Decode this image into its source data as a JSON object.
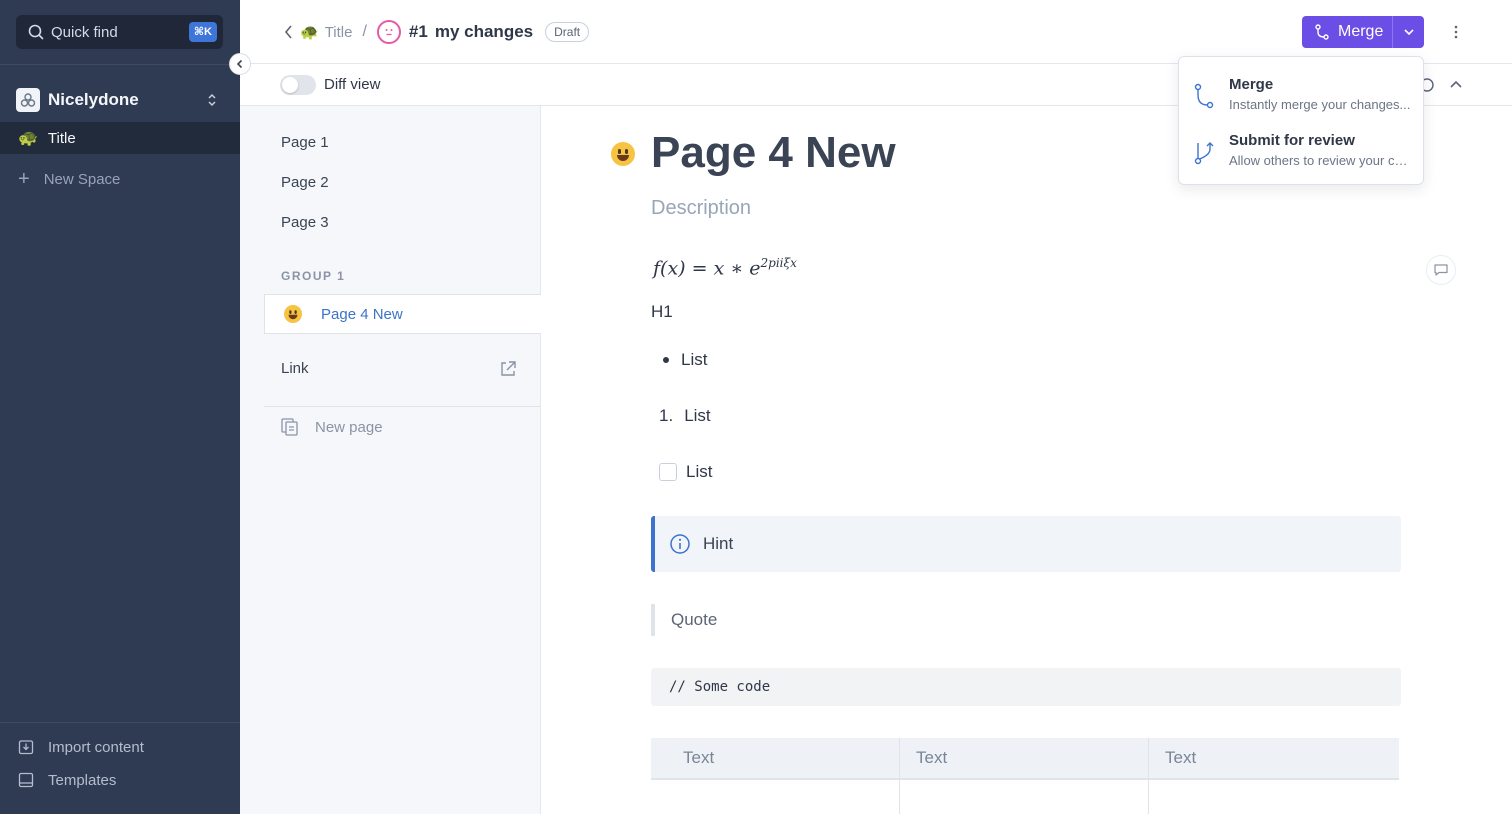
{
  "sidebar": {
    "search": {
      "label": "Quick find",
      "shortcut": "⌘K"
    },
    "space": {
      "name": "Nicelydone"
    },
    "active_item": {
      "label": "Title",
      "emoji": "🐢"
    },
    "new_space": "New Space",
    "bottom": {
      "import": "Import content",
      "templates": "Templates"
    }
  },
  "header": {
    "breadcrumb_title": "Title",
    "separator": "/",
    "change_number": "#1",
    "change_name": "my changes",
    "status_badge": "Draft",
    "merge_button": "Merge"
  },
  "toolbar": {
    "diff_label": "Diff view",
    "diff_enabled": false
  },
  "tree": {
    "pages": [
      "Page 1",
      "Page 2",
      "Page 3"
    ],
    "group_title": "GROUP 1",
    "active_page": "Page 4 New",
    "link": "Link",
    "new_page": "New page"
  },
  "content": {
    "title": "Page 4 New",
    "description": "Description",
    "math_base": "f(x) = x ∗ e",
    "math_exp": "2piiξx",
    "h1": "H1",
    "bullet": "List",
    "numbered_marker": "1.",
    "numbered": "List",
    "checkbox": "List",
    "hint": "Hint",
    "quote": "Quote",
    "code": "// Some code",
    "table_headers": [
      "Text",
      "Text",
      "Text"
    ]
  },
  "merge_menu": {
    "items": [
      {
        "title": "Merge",
        "desc": "Instantly merge your changes..."
      },
      {
        "title": "Submit for review",
        "desc": "Allow others to review your changes"
      }
    ]
  },
  "colors": {
    "sidebar_bg": "#2f3b52",
    "accent": "#6b4ee6",
    "link": "#3b74c8",
    "hint_border": "#3d73cf"
  }
}
